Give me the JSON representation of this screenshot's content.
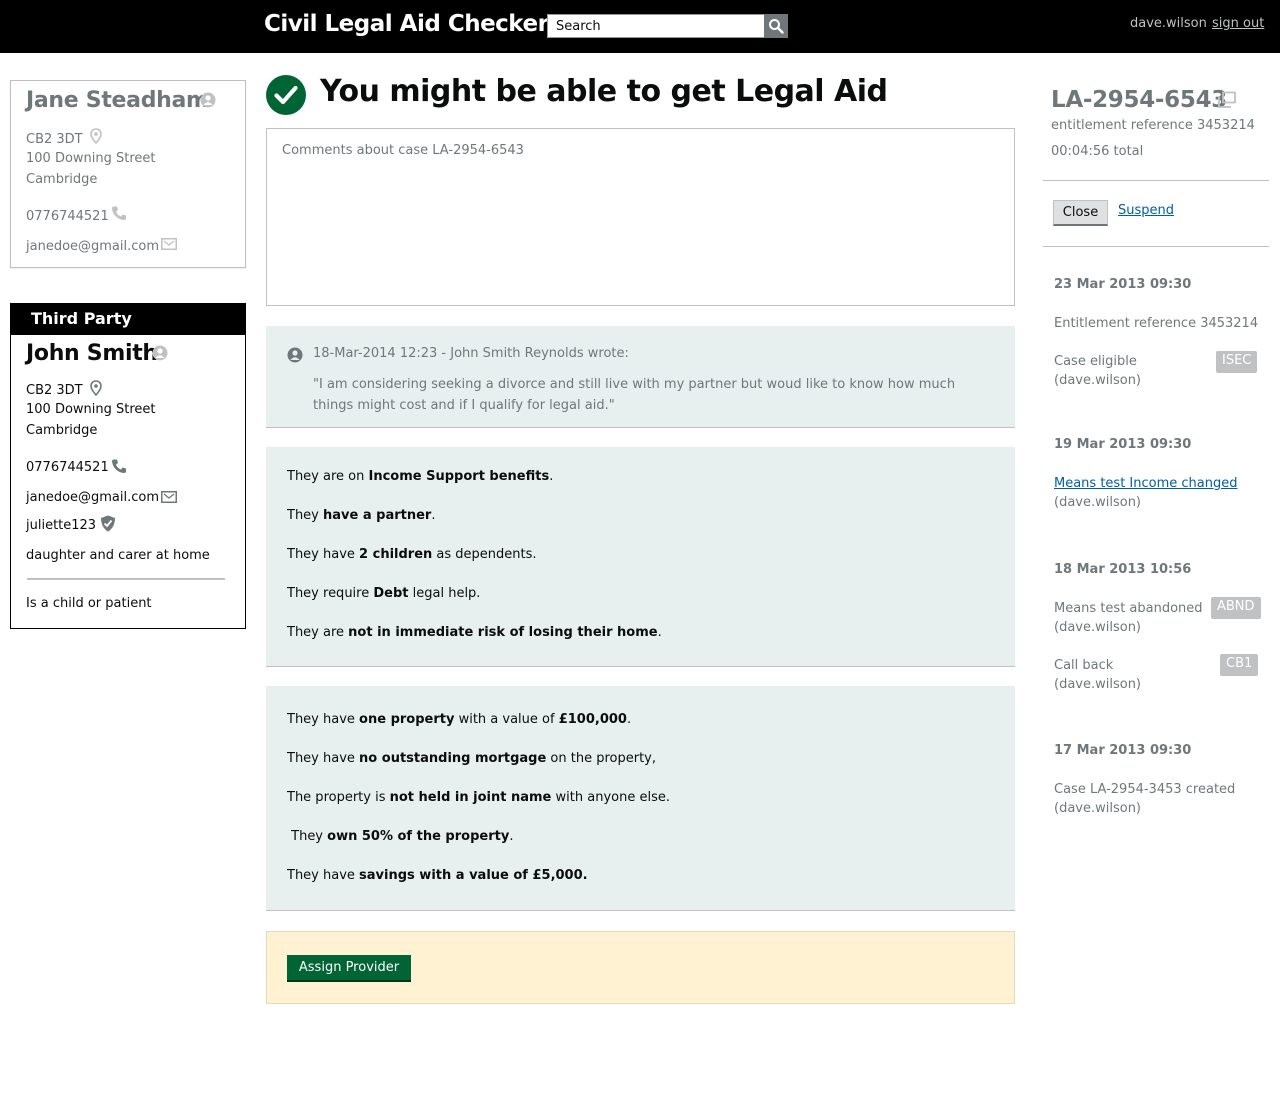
{
  "header": {
    "app_title": "Civil Legal Aid Checker",
    "search_placeholder": "Search",
    "user": "dave.wilson",
    "signout": "sign out"
  },
  "client": {
    "name": "Jane Steadham",
    "postcode": "CB2 3DT",
    "street": "100 Downing Street",
    "city": "Cambridge",
    "phone": "0776744521",
    "email": "janedoe@gmail.com"
  },
  "third_party": {
    "heading": "Third Party",
    "name": "John Smith",
    "postcode": "CB2 3DT",
    "street": "100 Downing Street",
    "city": "Cambridge",
    "phone": "0776744521",
    "email": "janedoe@gmail.com",
    "username": "juliette123",
    "relationship": "daughter and carer at home",
    "status": "Is a child or patient"
  },
  "main": {
    "headline": "You might be able to get Legal Aid",
    "comments_placeholder": "Comments about case LA-2954-6543",
    "note": {
      "meta": "18-Mar-2014 12:23 - John Smith Reynolds wrote:",
      "quote": "\"I am considering seeking a divorce and still live with my partner but woud like to know how much things might cost and if I qualify for legal aid.\""
    },
    "facts_group_1": [
      {
        "pre": "They are on ",
        "bold": "Income Support benefits",
        "post": "."
      },
      {
        "pre": "They ",
        "bold": "have a partner",
        "post": "."
      },
      {
        "pre": "They have ",
        "bold": "2 children",
        "post": " as dependents."
      },
      {
        "pre": "They require ",
        "bold": "Debt",
        "post": " legal help."
      },
      {
        "pre": "They are ",
        "bold": "not in immediate risk of losing their home",
        "post": "."
      }
    ],
    "facts_group_2": [
      {
        "pre": "They have ",
        "bold": "one property",
        "mid": " with a value of ",
        "bold2": "£100,000",
        "post": "."
      },
      {
        "pre": "They have ",
        "bold": "no outstanding mortgage",
        "post": " on the property,"
      },
      {
        "pre": "The property is ",
        "bold": "not held in joint name",
        "post": " with anyone else."
      },
      {
        "pre": " They ",
        "bold": "own 50% of the property",
        "post": "."
      },
      {
        "pre": "They have ",
        "bold": "savings with a value of £5,000.",
        "post": ""
      }
    ],
    "assign_button": "Assign Provider"
  },
  "case": {
    "reference": "LA-2954-6543",
    "entitlement": "entitlement reference 3453214",
    "total_time": "00:04:56 total",
    "close_button": "Close",
    "suspend_link": "Suspend"
  },
  "timeline": [
    {
      "date": "23 Mar 2013 09:30",
      "entries": [
        {
          "text": "Entitlement reference 3453214",
          "user": "",
          "badge": ""
        },
        {
          "text": "Case eligible",
          "user": "(dave.wilson)",
          "badge": "ISEC"
        }
      ]
    },
    {
      "date": "19 Mar 2013 09:30",
      "entries": [
        {
          "text": "Means test Income changed",
          "user": "(dave.wilson)",
          "badge": "",
          "link": true
        }
      ]
    },
    {
      "date": "18 Mar 2013 10:56",
      "entries": [
        {
          "text": "Means test abandoned",
          "user": "(dave.wilson)",
          "badge": "ABND"
        },
        {
          "text": "Call back",
          "user": "(dave.wilson)",
          "badge": "CB1"
        }
      ]
    },
    {
      "date": "17 Mar 2013 09:30",
      "entries": [
        {
          "text": "Case LA-2954-3453 created",
          "user": "(dave.wilson)",
          "badge": ""
        }
      ]
    }
  ],
  "colors": {
    "header_bg": "#000000",
    "success_green": "#006435",
    "panel_bg": "#e8efef",
    "assign_bg": "#fff2d3",
    "link_blue": "#005ea5",
    "muted_text": "#6f777b"
  },
  "icons": [
    "search-icon",
    "user-icon",
    "map-pin-icon",
    "phone-icon",
    "mail-icon",
    "shield-icon",
    "tick-icon",
    "copy-icon"
  ]
}
